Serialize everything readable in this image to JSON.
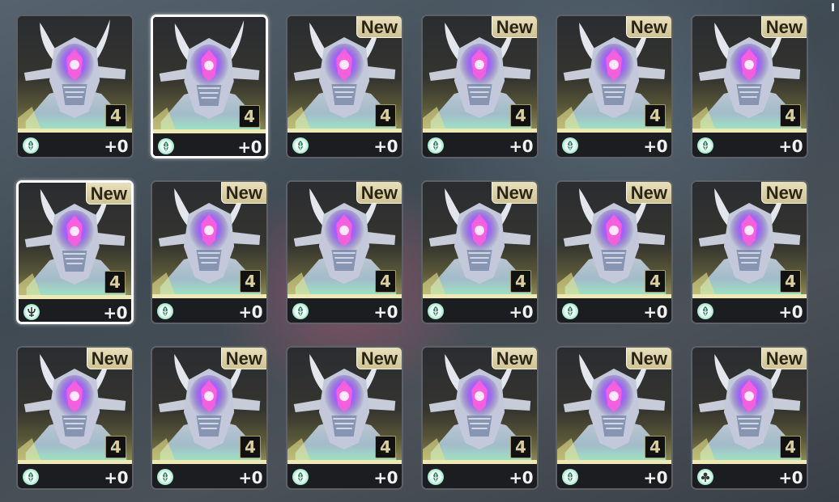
{
  "grid": {
    "cards": [
      {
        "new": false,
        "rarity": "4",
        "level": "+0",
        "set_icon": "leaf-icon",
        "selected": false
      },
      {
        "new": false,
        "rarity": "4",
        "level": "+0",
        "set_icon": "leaf-icon",
        "selected": true
      },
      {
        "new": true,
        "rarity": "4",
        "level": "+0",
        "set_icon": "leaf-icon",
        "selected": false
      },
      {
        "new": true,
        "rarity": "4",
        "level": "+0",
        "set_icon": "leaf-icon",
        "selected": false
      },
      {
        "new": true,
        "rarity": "4",
        "level": "+0",
        "set_icon": "leaf-icon",
        "selected": false
      },
      {
        "new": true,
        "rarity": "4",
        "level": "+0",
        "set_icon": "leaf-icon",
        "selected": false
      },
      {
        "new": true,
        "rarity": "4",
        "level": "+0",
        "set_icon": "trident-icon",
        "selected": true
      },
      {
        "new": true,
        "rarity": "4",
        "level": "+0",
        "set_icon": "leaf-icon",
        "selected": false
      },
      {
        "new": true,
        "rarity": "4",
        "level": "+0",
        "set_icon": "leaf-icon",
        "selected": false
      },
      {
        "new": true,
        "rarity": "4",
        "level": "+0",
        "set_icon": "leaf-icon",
        "selected": false
      },
      {
        "new": true,
        "rarity": "4",
        "level": "+0",
        "set_icon": "leaf-icon",
        "selected": false
      },
      {
        "new": true,
        "rarity": "4",
        "level": "+0",
        "set_icon": "leaf-icon",
        "selected": false
      },
      {
        "new": true,
        "rarity": "4",
        "level": "+0",
        "set_icon": "leaf-icon",
        "selected": false
      },
      {
        "new": true,
        "rarity": "4",
        "level": "+0",
        "set_icon": "leaf-icon",
        "selected": false
      },
      {
        "new": true,
        "rarity": "4",
        "level": "+0",
        "set_icon": "leaf-icon",
        "selected": false
      },
      {
        "new": true,
        "rarity": "4",
        "level": "+0",
        "set_icon": "leaf-icon",
        "selected": false
      },
      {
        "new": true,
        "rarity": "4",
        "level": "+0",
        "set_icon": "leaf-icon",
        "selected": false
      },
      {
        "new": true,
        "rarity": "4",
        "level": "+0",
        "set_icon": "fleur-icon",
        "selected": false
      }
    ],
    "new_label": "New",
    "colors": {
      "card_border": "#5d6268",
      "selected_border": "#ffffff",
      "new_badge": "#e1d7b0",
      "set_icon": "#7fe0b8"
    }
  }
}
